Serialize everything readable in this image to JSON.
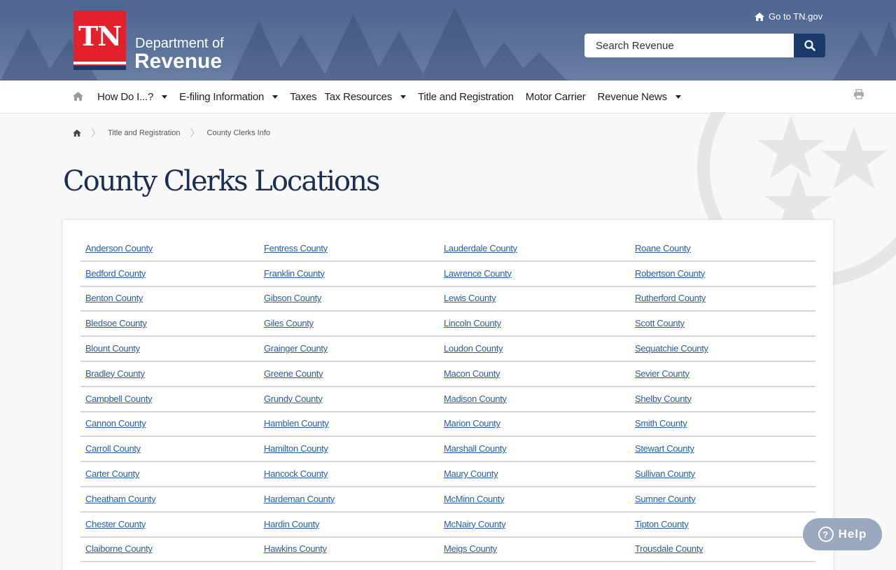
{
  "header": {
    "logo_letters": "TN",
    "dept_line1": "Department of",
    "dept_line2": "Revenue",
    "goto_label": "Go to TN.gov",
    "search_placeholder": "Search Revenue"
  },
  "nav": {
    "items": [
      {
        "label": "How Do I...?",
        "dropdown": true
      },
      {
        "label": "E-filing Information",
        "dropdown": true
      },
      {
        "label": "Taxes",
        "dropdown": false
      },
      {
        "label": "Tax Resources",
        "dropdown": true
      },
      {
        "label": "Title and Registration",
        "dropdown": false
      },
      {
        "label": "Motor Carrier",
        "dropdown": false
      },
      {
        "label": "Revenue News",
        "dropdown": true
      }
    ]
  },
  "breadcrumb": [
    "Title and Registration",
    "County Clerks Info"
  ],
  "page_title": "County Clerks Locations",
  "counties": [
    [
      "Anderson County",
      "Fentress County",
      "Lauderdale County",
      "Roane County"
    ],
    [
      "Bedford County",
      "Franklin County",
      "Lawrence County",
      "Robertson County"
    ],
    [
      "Benton County",
      "Gibson County",
      "Lewis County",
      "Rutherford County"
    ],
    [
      "Bledsoe County",
      "Giles County",
      "Lincoln County",
      "Scott County"
    ],
    [
      "Blount County",
      "Grainger County",
      "Loudon County",
      "Sequatchie County"
    ],
    [
      "Bradley County",
      "Greene County",
      "Macon County",
      "Sevier County"
    ],
    [
      "Campbell County",
      "Grundy County",
      "Madison County",
      "Shelby County"
    ],
    [
      "Cannon County",
      "Hamblen County",
      "Marion County",
      "Smith County"
    ],
    [
      "Carroll County",
      "Hamilton County",
      "Marshall County",
      "Stewart County"
    ],
    [
      "Carter County",
      "Hancock County",
      "Maury County",
      "Sullivan County"
    ],
    [
      "Cheatham County",
      "Hardeman County",
      "McMinn County",
      "Sumner County"
    ],
    [
      "Chester County",
      "Hardin County",
      "McNairy County",
      "Tipton County"
    ],
    [
      "Claiborne County",
      "Hawkins County",
      "Meigs County",
      "Trousdale County"
    ]
  ],
  "help_label": "Help",
  "colors": {
    "header_blue": "#5b7299",
    "logo_red": "#e4202c",
    "navy": "#1b3a6b",
    "link": "#2a5da8"
  }
}
